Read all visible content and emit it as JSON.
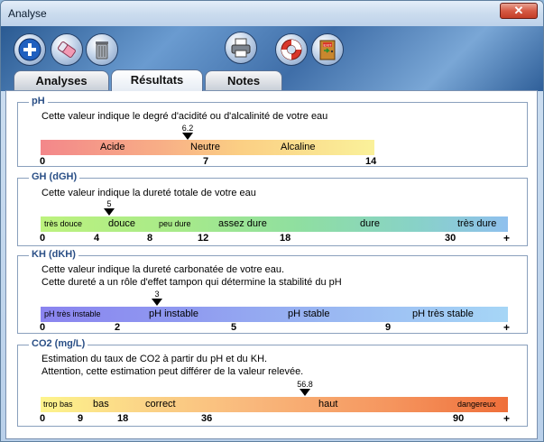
{
  "window": {
    "title": "Analyse",
    "close_label": "✕"
  },
  "toolbar": {
    "add_icon": "plus-icon",
    "erase_icon": "eraser-icon",
    "delete_icon": "trash-icon",
    "print_icon": "printer-icon",
    "help_icon": "lifebuoy-icon",
    "exit_icon": "exit-door-icon",
    "exit_label": "EXIT"
  },
  "tabs": [
    {
      "label": "Analyses",
      "active": false
    },
    {
      "label": "Résultats",
      "active": true
    },
    {
      "label": "Notes",
      "active": false
    }
  ],
  "sections": {
    "ph": {
      "title": "pH",
      "desc": [
        "Cette valeur indique le degré d'acidité ou d'alcalinité de votre eau"
      ],
      "value": "6.2",
      "segments": [
        "Acide",
        "Neutre",
        "Alcaline"
      ],
      "ticks": [
        "0",
        "7",
        "14"
      ]
    },
    "gh": {
      "title": "GH (dGH)",
      "desc": [
        "Cette valeur indique la dureté totale de votre eau"
      ],
      "value": "5",
      "segments": [
        "très douce",
        "douce",
        "peu dure",
        "assez dure",
        "dure",
        "très dure"
      ],
      "ticks": [
        "0",
        "4",
        "8",
        "12",
        "18",
        "30",
        "+"
      ]
    },
    "kh": {
      "title": "KH (dKH)",
      "desc": [
        "Cette valeur indique la dureté carbonatée de votre eau.",
        "Cette dureté a un rôle d'effet tampon qui détermine la stabilité du pH"
      ],
      "value": "3",
      "segments": [
        "pH très instable",
        "pH instable",
        "pH stable",
        "pH très stable"
      ],
      "ticks": [
        "0",
        "2",
        "5",
        "9",
        "+"
      ]
    },
    "co2": {
      "title": "CO2 (mg/L)",
      "desc": [
        "Estimation du taux de CO2 à partir du pH et du KH.",
        "Attention, cette estimation peut différer de la valeur relevée."
      ],
      "value": "56.8",
      "segments": [
        "trop bas",
        "bas",
        "correct",
        "haut",
        "dangereux"
      ],
      "ticks": [
        "0",
        "9",
        "18",
        "36",
        "90",
        "+"
      ]
    }
  }
}
